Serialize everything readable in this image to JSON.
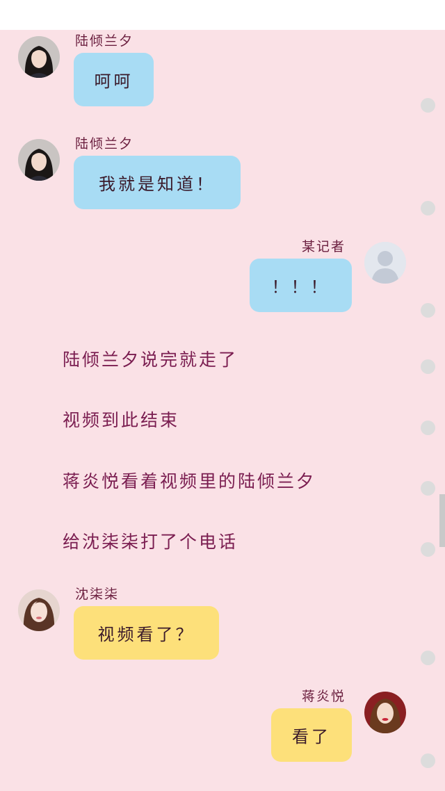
{
  "messages": [
    {
      "sender": "陆倾兰夕",
      "text": "呵呵",
      "color": "#a8dcf4",
      "side": "left"
    },
    {
      "sender": "陆倾兰夕",
      "text": "我就是知道！",
      "color": "#a8dcf4",
      "side": "left"
    },
    {
      "sender": "某记者",
      "text": "！！！",
      "color": "#a8dcf4",
      "side": "right"
    },
    {
      "sender": "沈柒柒",
      "text": "视频看了？",
      "color": "#fde07a",
      "side": "left"
    },
    {
      "sender": "蒋炎悦",
      "text": "看了",
      "color": "#fde07a",
      "side": "right"
    }
  ],
  "narration": [
    "陆倾兰夕说完就走了",
    "视频到此结束",
    "蒋炎悦看着视频里的陆倾兰夕",
    "给沈柒柒打了个电话"
  ],
  "icons": {
    "avatar_luqinglanxi": "woman-dark-hair-avatar",
    "avatar_reporter": "default-person-avatar",
    "avatar_shenqiqi": "woman-portrait-avatar",
    "avatar_jiangyanyue": "woman-red-lips-avatar",
    "message_dot": "circle-icon"
  },
  "colors": {
    "background": "#fae1e6",
    "blue_bubble": "#a8dcf4",
    "yellow_bubble": "#fde07a",
    "name_text": "#6b1f3f",
    "narration_text": "#7a1d50"
  }
}
